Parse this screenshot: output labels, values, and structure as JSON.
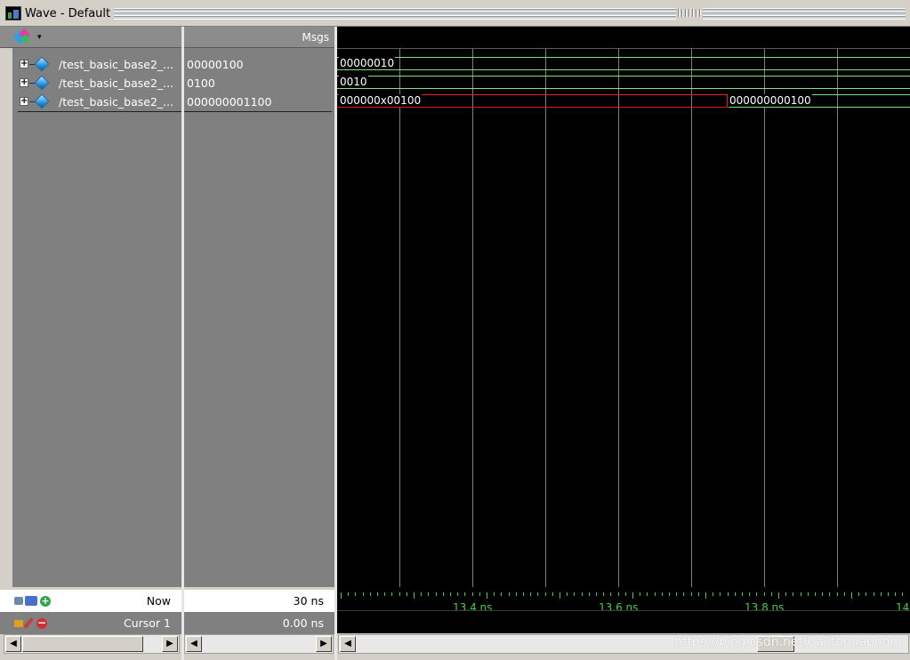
{
  "window": {
    "title": "Wave - Default"
  },
  "header": {
    "msgs_label": "Msgs"
  },
  "signals": [
    {
      "name": "/test_basic_base2_...",
      "value": "00000100"
    },
    {
      "name": "/test_basic_base2_...",
      "value": "0100"
    },
    {
      "name": "/test_basic_base2_...",
      "value": "000000001100"
    }
  ],
  "waveform": {
    "bus_labels": [
      "00000010",
      "0010",
      "000000x00100",
      "000000000100"
    ],
    "colors": {
      "normal": "#7fe07f",
      "unknown": "#e02020",
      "grid": "#808080",
      "timeline": "#40d040"
    }
  },
  "footer": {
    "now_label": "Now",
    "now_value": "30 ns",
    "cursor_label": "Cursor 1",
    "cursor_value": "0.00 ns"
  },
  "timeline": {
    "labels": [
      "13.4 ns",
      "13.6 ns",
      "13.8 ns",
      "14"
    ]
  },
  "watermark": "https://blog.csdn.net/Californiaboom"
}
